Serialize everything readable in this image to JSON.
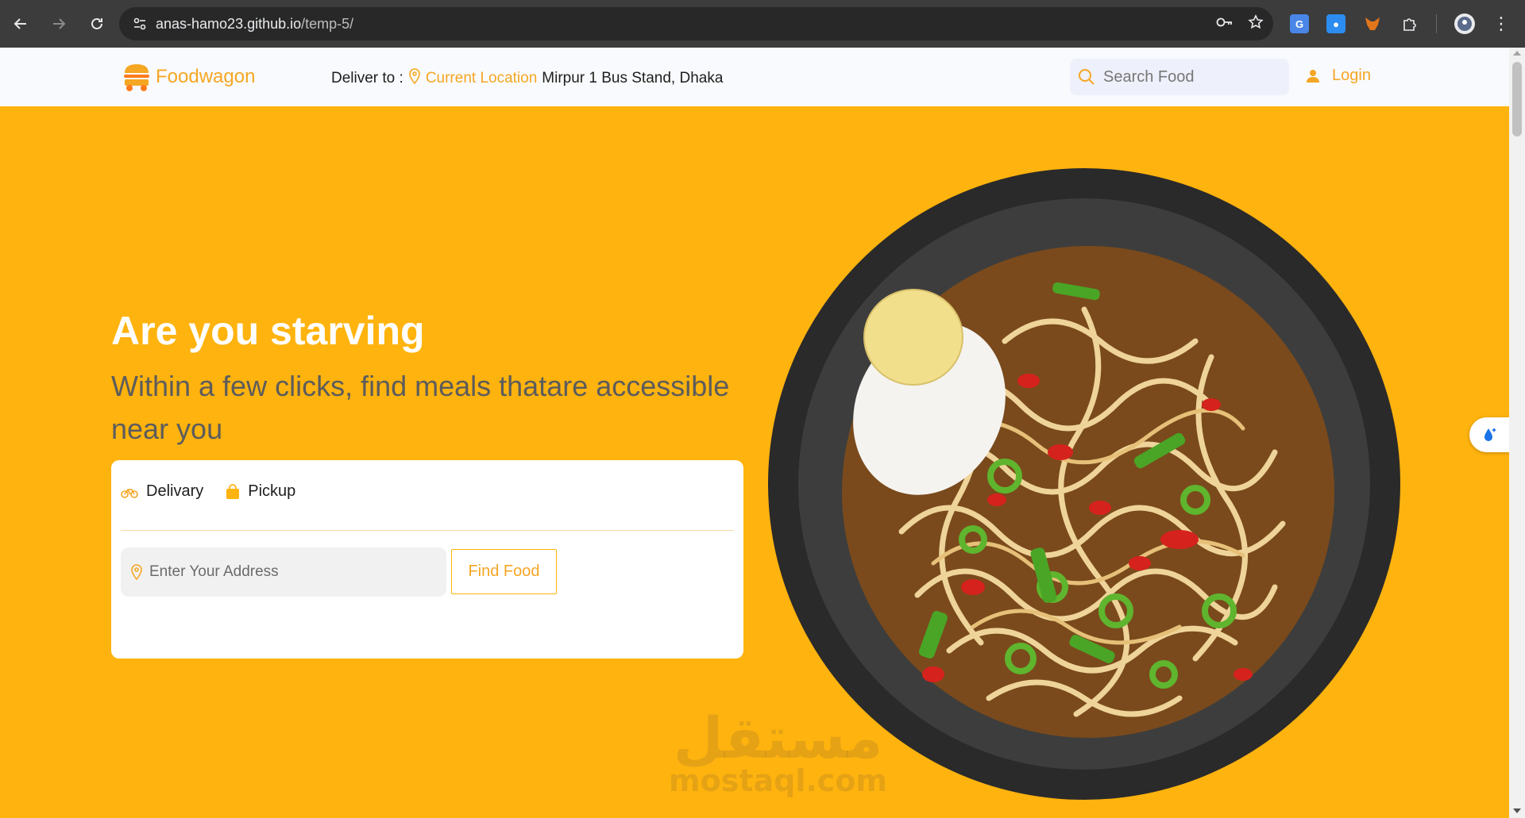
{
  "browser": {
    "url_host": "anas-hamo23.github.io",
    "url_path": "/temp-5/"
  },
  "header": {
    "logo_text": "Foodwagon",
    "deliver_label": "Deliver to :",
    "current_location": "Current Location",
    "address": "Mirpur 1 Bus Stand, Dhaka",
    "search_placeholder": "Search Food",
    "login_label": "Login"
  },
  "hero": {
    "title": "Are you starving",
    "subtitle": "Within a few clicks, find meals thatare accessible near you",
    "tabs": [
      {
        "label": "Delivary",
        "icon": "bike-icon"
      },
      {
        "label": "Pickup",
        "icon": "shopping-bag-icon"
      }
    ],
    "address_placeholder": "Enter Your Address",
    "find_button": "Find Food"
  },
  "watermark": {
    "arabic": "مستقل",
    "latin": "mostaql.com"
  },
  "colors": {
    "accent": "#ffb30e",
    "brand_text": "#f5a623",
    "header_bg": "#f9fafd"
  }
}
